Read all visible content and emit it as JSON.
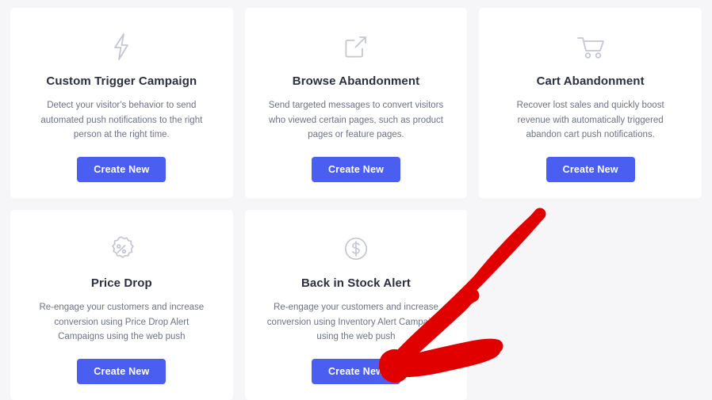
{
  "theme": {
    "page_background": "#f6f6f9",
    "card_background": "#ffffff",
    "button_color": "#4a5ef1",
    "button_text_color": "#ffffff",
    "title_color": "#2b2f42",
    "description_color": "#6e7288",
    "icon_color": "#c4c6d4",
    "annotation_color": "#e00000"
  },
  "cards": [
    {
      "icon": "lightning-bolt-icon",
      "title": "Custom Trigger Campaign",
      "description": "Detect your visitor's behavior to send automated push notifications to the right person at the right time.",
      "button_label": "Create New"
    },
    {
      "icon": "external-link-icon",
      "title": "Browse Abandonment",
      "description": "Send targeted messages to convert visitors who viewed certain pages, such as product pages or feature pages.",
      "button_label": "Create New"
    },
    {
      "icon": "shopping-cart-icon",
      "title": "Cart Abandonment",
      "description": "Recover lost sales and quickly boost revenue with automatically triggered abandon cart push notifications.",
      "button_label": "Create New"
    },
    {
      "icon": "percent-badge-icon",
      "title": "Price Drop",
      "description": "Re-engage your customers and increase conversion using Price Drop Alert Campaigns using the web push",
      "button_label": "Create New"
    },
    {
      "icon": "dollar-circle-icon",
      "title": "Back in Stock Alert",
      "description": "Re-engage your customers and increase conversion using Inventory Alert Campaigns using the web push",
      "button_label": "Create New"
    }
  ],
  "annotation": {
    "name": "red-arrow-annotation",
    "points_to": "Back in Stock Alert Create New button"
  }
}
